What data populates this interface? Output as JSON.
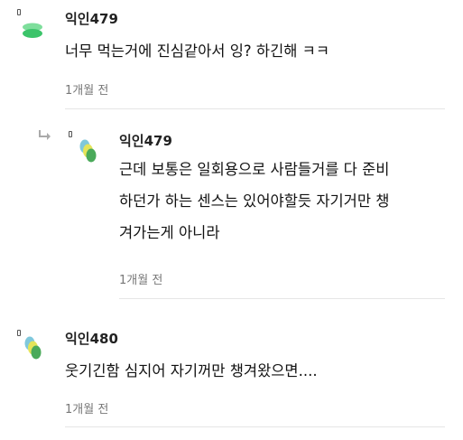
{
  "comments": [
    {
      "nickname": "익인479",
      "text": "너무 먹는거에 진심같아서 잉? 하긴해 ㅋㅋ",
      "time": "1개월 전",
      "avatar_icon": "green-stack-avatar-icon",
      "avatar_colors": [
        "#3cc46a",
        "#7ede9c"
      ]
    },
    {
      "nickname": "익인479",
      "text": "근데 보통은 일회용으로 사람들거를 다 준비\n하던가 하는 센스는 있어야할듯 자기거만 챙\n겨가는게 아니라",
      "time": "1개월 전",
      "is_reply": true,
      "reply_icon": "reply-arrow-icon",
      "avatar_icon": "blue-yellow-green-avatar-icon",
      "avatar_colors": [
        "#7fc8dc",
        "#e4e45a",
        "#4aaa5a"
      ]
    },
    {
      "nickname": "익인480",
      "text": "웃기긴함 심지어 자기꺼만 챙겨왔으면....",
      "time": "1개월 전",
      "avatar_icon": "blue-yellow-green-avatar-icon",
      "avatar_colors": [
        "#7fc8dc",
        "#e4e45a",
        "#4aaa5a"
      ]
    }
  ]
}
